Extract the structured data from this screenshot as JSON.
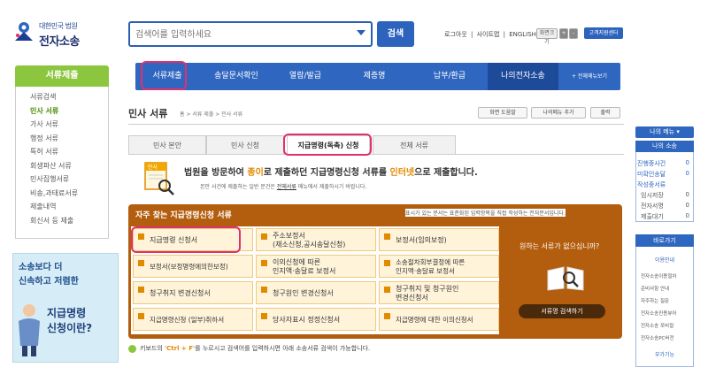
{
  "header": {
    "logo_small": "대한민국 법원",
    "logo_big": "전자소송",
    "search_placeholder": "검색어를 입력하세요",
    "search_button": "검색",
    "util_links": [
      "로그아웃",
      "|",
      "사이트맵",
      "|",
      "ENGLISH"
    ],
    "font_label": "화면크기",
    "font_plus": "+",
    "font_minus": "-",
    "customer_center": "고객지원센터"
  },
  "left_nav": {
    "title": "서류제출",
    "items": [
      {
        "label": "서류검색",
        "active": false
      },
      {
        "label": "민사 서류",
        "active": true
      },
      {
        "label": "가사 서류",
        "active": false
      },
      {
        "label": "행정 서류",
        "active": false
      },
      {
        "label": "특허 서류",
        "active": false
      },
      {
        "label": "회생파산 서류",
        "active": false
      },
      {
        "label": "민사집행서류",
        "active": false
      },
      {
        "label": "비송,과태료서류",
        "active": false
      },
      {
        "label": "제출내역",
        "active": false
      },
      {
        "label": "회신서 등 제출",
        "active": false
      }
    ]
  },
  "banner": {
    "line1": "소송보다 더",
    "line2": "신속하고 저렴한",
    "title1": "지급명령",
    "title2": "신청이란?"
  },
  "top_nav": {
    "items": [
      "서류제출",
      "송달문서확인",
      "열람/발급",
      "제증명",
      "납부/환급",
      "나의전자소송",
      "+ 전체메뉴보기"
    ]
  },
  "content": {
    "title": "민사 서류",
    "breadcrumb": "홈 > 서류 제출 > 민사 서류",
    "tools": [
      "화면 도움말",
      "나의메뉴 추가",
      "출력"
    ],
    "tabs": [
      {
        "label": "민사 본안",
        "active": false
      },
      {
        "label": "민사 신청",
        "active": false
      },
      {
        "label": "지급명령(독촉) 신청",
        "active": true
      },
      {
        "label": "전체 서류",
        "active": false
      }
    ],
    "notice_icon_label": "민사",
    "notice_pre": "법원을 방문하여 ",
    "notice_paper": "종이",
    "notice_mid": "로 제출하던 지급명령신청 서류를 ",
    "notice_internet": "인터넷",
    "notice_post": "으로 제출합니다.",
    "notice_sub_pre": "본안 사건에 제출하는 일반 문건은 ",
    "notice_sub_link": "전체서류",
    "notice_sub_post": " 메뉴에서 제출하시기 바랍니다.",
    "panel_title": "자주 찾는 지급명령신청 서류",
    "panel_note": "표시가 있는 문서는 표준화된 입력항목을 직접 작성하는 전자문서입니다.",
    "documents": [
      [
        "지급명령 신청서",
        "주소보정서\n(재소신청,공시송달신청)",
        "보정서(임의보정)"
      ],
      [
        "보정서(보정명령에의한보정)",
        "이의신청에 따른\n인지액·송달료 보정서",
        "소송절차회부결정에 따른\n인지액·송달료 보정서"
      ],
      [
        "청구취지 변경신청서",
        "청구원인 변경신청서",
        "청구취지 및 청구원인\n변경신청서"
      ],
      [
        "지급명령신청 (일부)취하서",
        "당사자표시 정정신청서",
        "지급명령에 대한 이의신청서"
      ]
    ],
    "help_text": "원하는 서류가 없으십니까?",
    "doc_search_button": "서류명 검색하기",
    "kb_hint_pre": "키보드의 ",
    "kb_hint_key": "'Ctrl + F'",
    "kb_hint_post": "를 누르시고 검색어를 입력하시면 아래 소송서류 검색이 가능합니다."
  },
  "right_sidebar": {
    "my_menu": "나의 메뉴 ▾",
    "my_case_title": "나의 소송",
    "case_rows": [
      {
        "label": "진행중사건",
        "count": "0"
      },
      {
        "label": "미확인송달",
        "count": "0"
      },
      {
        "label": "작성중서류",
        "count": ""
      },
      {
        "label": "임시저장",
        "count": "0"
      },
      {
        "label": "전자서명",
        "count": "0"
      },
      {
        "label": "제출대기",
        "count": "0"
      }
    ],
    "quick_title": "바로가기",
    "quick_sub": "이용안내",
    "quick_items": [
      "전자소송이용절차",
      "준비사항 안내",
      "자주하는 질문",
      "전자소송진용뷰어",
      "전자소송 포비컬",
      "전자소송PC버전"
    ],
    "quick_sub2": "부가기능"
  },
  "colors": {
    "accent_blue": "#2f66bf",
    "green": "#8cc63f",
    "orange_panel": "#b35d0e",
    "highlight": "#e0306e"
  }
}
